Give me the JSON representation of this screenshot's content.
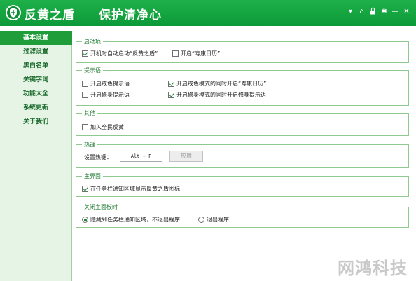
{
  "app": {
    "name": "反黄之盾",
    "slogan": "保护清净心",
    "logo_icon": "shield-icon",
    "brand_color": "#0e9a3a",
    "controls": [
      "dropdown-icon",
      "home-icon",
      "lock-icon",
      "gear-icon",
      "minimize-icon",
      "close-icon"
    ]
  },
  "sidebar": {
    "items": [
      {
        "label": "基本设置",
        "active": true
      },
      {
        "label": "过滤设置",
        "active": false
      },
      {
        "label": "黑白名单",
        "active": false
      },
      {
        "label": "关键字词",
        "active": false
      },
      {
        "label": "功能大全",
        "active": false
      },
      {
        "label": "系统更新",
        "active": false
      },
      {
        "label": "关于我们",
        "active": false
      }
    ]
  },
  "startup": {
    "title": "启动项",
    "options": [
      {
        "label": "开机时自动启动“反黄之盾”",
        "checked": true
      },
      {
        "label": "开启“寿康日历”",
        "checked": false
      }
    ]
  },
  "prompt": {
    "title": "提示语",
    "options": [
      {
        "label": "开启戒色提示语",
        "checked": false
      },
      {
        "label": "开启戒色模式的同时开启“寿康日历”",
        "checked": true
      },
      {
        "label": "开启修身提示语",
        "checked": false
      },
      {
        "label": "开启修身模式的同时开启修身提示语",
        "checked": true
      }
    ]
  },
  "other": {
    "title": "其他",
    "options": [
      {
        "label": "加入全民反黄",
        "checked": false
      }
    ]
  },
  "hotkey": {
    "title": "热键",
    "label": "设置热键：",
    "value": "Alt + F",
    "apply_label": "应用"
  },
  "main_ui": {
    "title": "主界面",
    "options": [
      {
        "label": "在任务栏通知区域显示反黄之盾图标",
        "checked": true
      }
    ]
  },
  "close_main": {
    "title": "关闭主面板时",
    "options": [
      {
        "label": "隐藏到任务栏通知区域，不退出程序",
        "selected": true
      },
      {
        "label": "退出程序",
        "selected": false
      }
    ]
  },
  "watermark": "网鸿科技"
}
